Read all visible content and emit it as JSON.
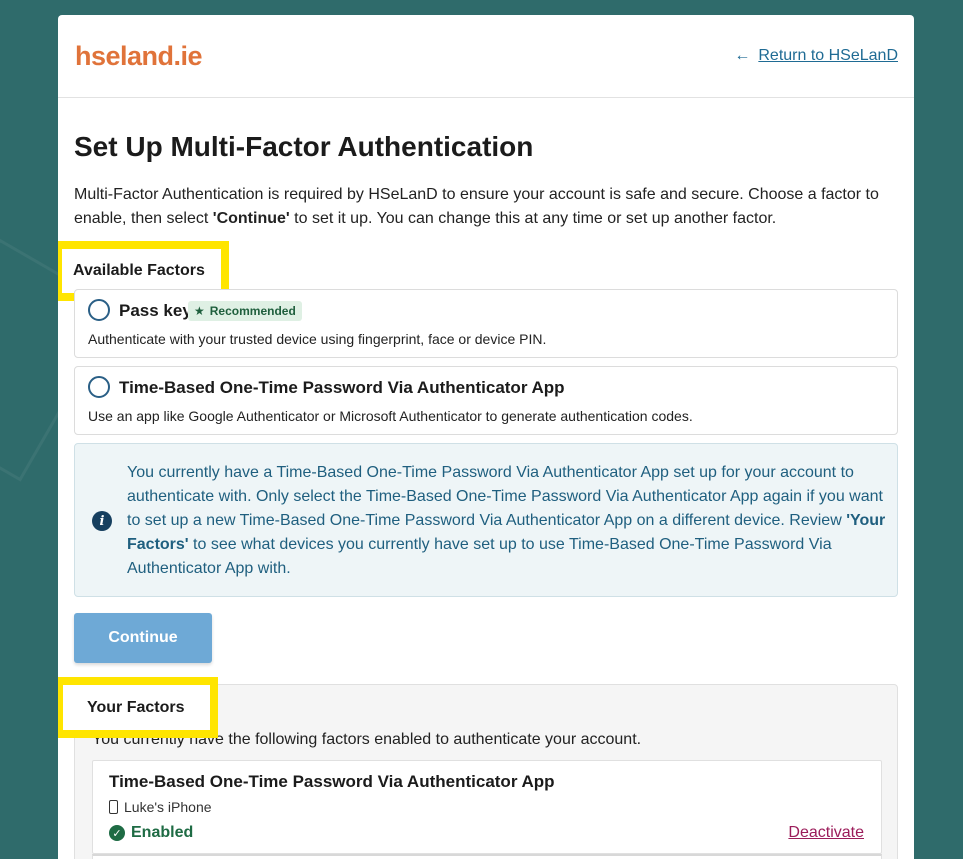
{
  "header": {
    "logo": "hseland.ie",
    "return_link": "Return to HSeLanD"
  },
  "page": {
    "title": "Set Up Multi-Factor Authentication",
    "intro_1": "Multi-Factor Authentication is required by HSeLanD to ensure your account is safe and secure. Choose a factor to enable, then select ",
    "intro_bold": "'Continue'",
    "intro_2": " to set it up. You can change this at any time or set up another factor."
  },
  "available": {
    "label": "Available Factors",
    "factors": [
      {
        "title": "Pass key",
        "badge": "Recommended",
        "description": "Authenticate with your trusted device using fingerprint, face or device PIN."
      },
      {
        "title": "Time-Based One-Time Password Via Authenticator App",
        "description": "Use an app like Google Authenticator or Microsoft Authenticator to generate authentication codes."
      }
    ]
  },
  "info": {
    "text_1": "You currently have a Time-Based One-Time Password Via Authenticator App set up for your account to authenticate with. Only select the Time-Based One-Time Password Via Authenticator App again if you want to set up a new Time-Based One-Time Password Via Authenticator App on a different device. Review ",
    "text_bold": "'Your Factors'",
    "text_2": " to see what devices you currently have set up to use Time-Based One-Time Password Via Authenticator App with."
  },
  "continue_label": "Continue",
  "your_factors": {
    "label": "Your Factors",
    "description": "You currently have the following factors enabled to authenticate your account.",
    "items": [
      {
        "title": "Time-Based One-Time Password Via Authenticator App",
        "device": "Luke's iPhone",
        "status": "Enabled",
        "action": "Deactivate"
      }
    ]
  },
  "colors": {
    "background": "#2f6b6b",
    "logo": "#e0733a",
    "link": "#1f6b94",
    "highlight": "#ffe500",
    "continue": "#6ea9d6",
    "enabled": "#1e6b44",
    "deactivate": "#9b1c5a"
  }
}
